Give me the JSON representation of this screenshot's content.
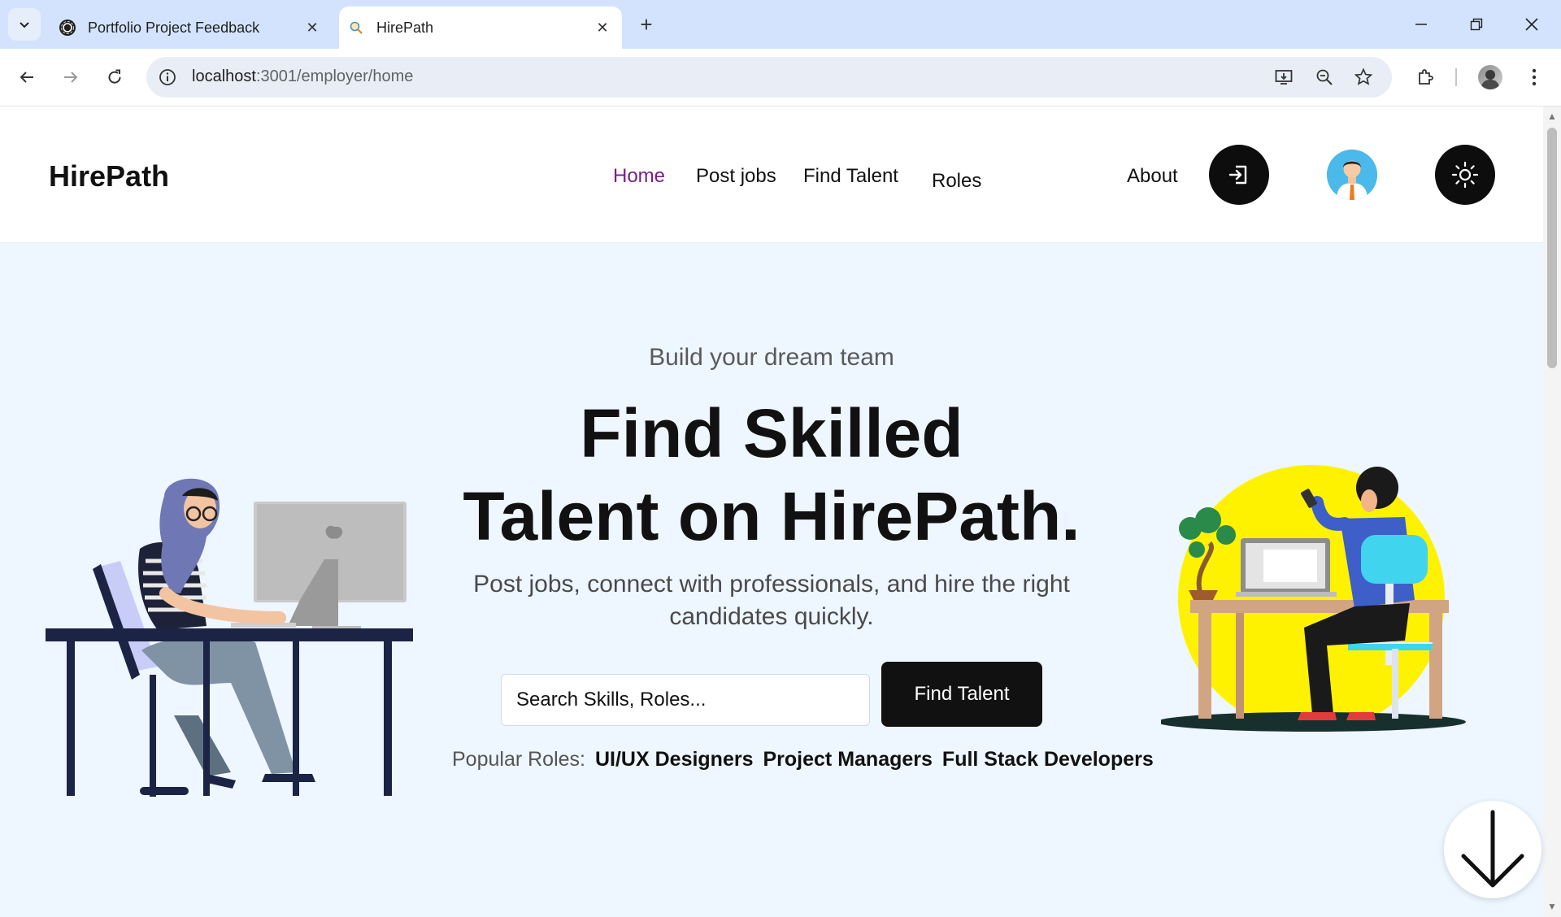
{
  "browser": {
    "tabs": [
      {
        "title": "Portfolio Project Feedback",
        "favicon": "openai-icon",
        "active": false
      },
      {
        "title": "HirePath",
        "favicon": "search-icon",
        "active": true
      }
    ],
    "url_host": "localhost",
    "url_rest": ":3001/employer/home"
  },
  "header": {
    "logo": "HirePath",
    "nav": [
      "Home",
      "Post jobs",
      "Find Talent",
      "Roles",
      "About"
    ],
    "active_nav": "Home",
    "accent_color": "#7a1c8e"
  },
  "hero": {
    "subtitle": "Build your dream team",
    "title_line1": "Find Skilled",
    "title_line2": "Talent on HirePath.",
    "description": "Post jobs, connect with professionals, and hire the right candidates quickly.",
    "search_placeholder": "Search Skills, Roles...",
    "button_label": "Find Talent",
    "popular_label": "Popular Roles:",
    "popular_roles": [
      "UI/UX Designers",
      "Project Managers",
      "Full Stack Developers"
    ]
  }
}
